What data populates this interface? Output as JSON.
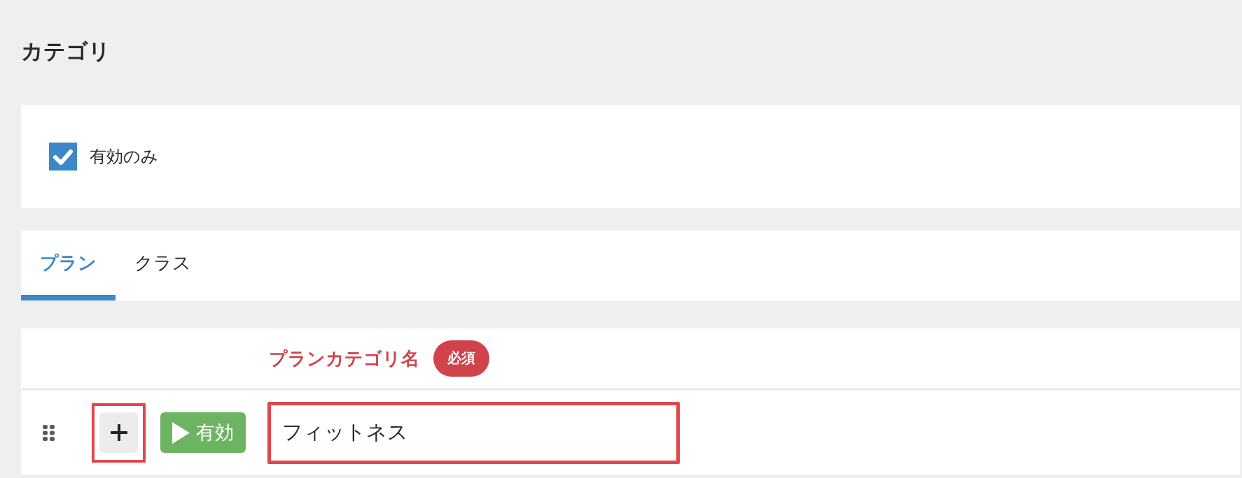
{
  "page": {
    "title": "カテゴリ"
  },
  "filter": {
    "label": "有効のみ",
    "checked": true
  },
  "tabs": [
    {
      "label": "プラン",
      "selected": true
    },
    {
      "label": "クラス",
      "selected": false
    }
  ],
  "table": {
    "columns": [
      {
        "label": "プランカテゴリ名",
        "required": true,
        "badge": "必須"
      }
    ],
    "rows": [
      {
        "add_button": {
          "highlighted": true
        },
        "status": {
          "label": "有効",
          "active": true
        },
        "name": "フィットネス",
        "name_highlighted": true
      }
    ]
  }
}
